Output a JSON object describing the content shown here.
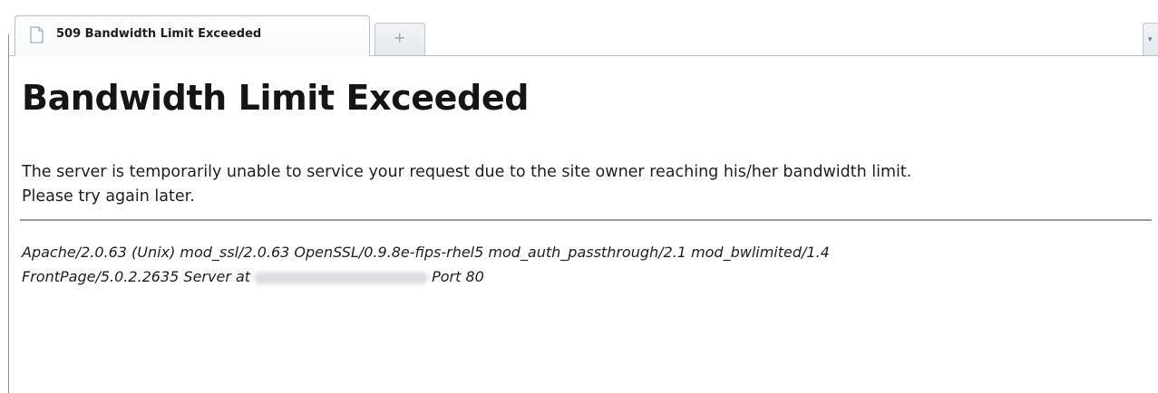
{
  "tab": {
    "active_title": "509 Bandwidth Limit Exceeded",
    "new_tab_symbol": "+",
    "tab_list_symbol": "▾"
  },
  "icons": {
    "tab_icon": "page-icon"
  },
  "page": {
    "heading": "Bandwidth Limit Exceeded",
    "message_line1": "The server is temporarily unable to service your request due to the site owner reaching his/her bandwidth limit.",
    "message_line2": "Please try again later.",
    "signature_line1": "Apache/2.0.63 (Unix) mod_ssl/2.0.63 OpenSSL/0.9.8e-fips-rhel5 mod_auth_passthrough/2.1 mod_bwlimited/1.4",
    "signature_line2_prefix": "FrontPage/5.0.2.2635 Server at",
    "signature_line2_suffix": "Port 80"
  },
  "colors": {
    "text": "#1f1f1f",
    "rule": "#9a9a9a",
    "tab_border": "#b8bec8"
  }
}
